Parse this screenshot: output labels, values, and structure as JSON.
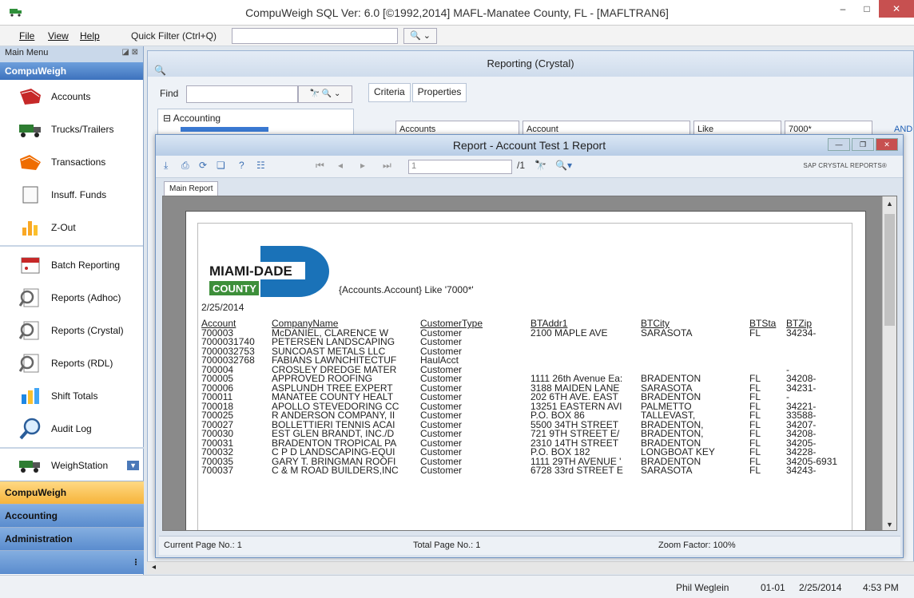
{
  "window": {
    "title": "CompuWeigh SQL Ver: 6.0 [©1992,2014]  MAFL-Manatee County, FL - [MAFLTRAN6]",
    "minimize": "–",
    "maximize": "□",
    "close": "✕"
  },
  "menubar": {
    "file": "File",
    "view": "View",
    "help": "Help",
    "quick_filter_label": "Quick Filter (Ctrl+Q)",
    "quick_filter_value": "",
    "quick_filter_btn": "🔍 ⌄"
  },
  "nav": {
    "header": "Main Menu",
    "group": "CompuWeigh",
    "items": [
      {
        "label": "Accounts"
      },
      {
        "label": "Trucks/Trailers"
      },
      {
        "label": "Transactions"
      },
      {
        "label": "Insuff. Funds",
        "icon_text": "IOU"
      },
      {
        "label": "Z-Out"
      }
    ],
    "items2": [
      {
        "label": "Batch Reporting"
      },
      {
        "label": "Reports (Adhoc)"
      },
      {
        "label": "Reports (Crystal)"
      },
      {
        "label": "Reports (RDL)"
      },
      {
        "label": "Shift Totals"
      },
      {
        "label": "Audit Log"
      }
    ],
    "weighstation": "WeighStation",
    "tabs": [
      "CompuWeigh",
      "Accounting",
      "Administration"
    ]
  },
  "reporting": {
    "title": "Reporting (Crystal)",
    "find_label": "Find",
    "find_buttons": "🔭 🔍 ⌄",
    "tree_root": "⊟ Accounting",
    "tabs": [
      "Criteria",
      "Properties"
    ],
    "criteria": [
      "Accounts",
      "Account",
      "Like",
      "7000*"
    ],
    "and_link": "AND"
  },
  "report": {
    "title": "Report - Account Test 1 Report",
    "page_box": "1",
    "page_of": "/1",
    "brand": "SAP CRYSTAL REPORTS®",
    "main_tab": "Main Report",
    "logo_top": "MIAMI-DADE",
    "logo_bottom": "COUNTY",
    "criteria_text": "{Accounts.Account} Like '7000*'",
    "date": "2/25/2014",
    "columns": [
      "Account",
      "CompanyName",
      "CustomerType",
      "BTAddr1",
      "BTCity",
      "BTSta",
      "BTZip"
    ],
    "rows": [
      [
        "700003",
        "McDANIEL, CLARENCE W",
        "Customer",
        "2100 MAPLE AVE",
        "SARASOTA",
        "FL",
        "34234-"
      ],
      [
        "7000031740",
        "PETERSEN LANDSCAPING",
        "Customer",
        "",
        "",
        "",
        ""
      ],
      [
        "7000032753",
        "SUNCOAST METALS LLC",
        "Customer",
        "",
        "",
        "",
        ""
      ],
      [
        "7000032768",
        "FABIANS LAWNCHITECTUF",
        "HaulAcct",
        "",
        "",
        "",
        ""
      ],
      [
        "700004",
        "CROSLEY DREDGE MATER",
        "Customer",
        "",
        "",
        "",
        "-"
      ],
      [
        "700005",
        "APPROVED ROOFING",
        "Customer",
        "1111 26th Avenue Ea:",
        "BRADENTON",
        "FL",
        "34208-"
      ],
      [
        "700006",
        "ASPLUNDH TREE EXPERT",
        "Customer",
        "3188 MAIDEN LANE",
        "SARASOTA",
        "FL",
        "34231-"
      ],
      [
        "700011",
        "MANATEE COUNTY HEALT",
        "Customer",
        "202 6TH AVE. EAST",
        "BRADENTON",
        "FL",
        "-"
      ],
      [
        "700018",
        "APOLLO STEVEDORING CC",
        "Customer",
        "13251 EASTERN AVI",
        "PALMETTO",
        "FL",
        "34221-"
      ],
      [
        "700025",
        "R ANDERSON COMPANY, II",
        "Customer",
        "P.O. BOX 86",
        "TALLEVAST,",
        "FL",
        "33588-"
      ],
      [
        "700027",
        "BOLLETTIERI TENNIS ACAI",
        "Customer",
        "5500 34TH STREET",
        "BRADENTON,",
        "FL",
        "34207-"
      ],
      [
        "700030",
        "EST GLEN BRANDT, INC./D",
        "Customer",
        "721 9TH STREET E/",
        "BRADENTON,",
        "FL",
        "34208-"
      ],
      [
        "700031",
        "BRADENTON TROPICAL PA",
        "Customer",
        "2310 14TH STREET",
        "BRADENTON",
        "FL",
        "34205-"
      ],
      [
        "700032",
        "C P D LANDSCAPING-EQUI",
        "Customer",
        "P.O. BOX 182",
        "LONGBOAT KEY",
        "FL",
        "34228-"
      ],
      [
        "700035",
        "GARY T. BRINGMAN ROOFI",
        "Customer",
        "1111 29TH AVENUE '",
        "BRADENTON",
        "FL",
        "34205-6931"
      ],
      [
        "700037",
        "C & M ROAD BUILDERS,INC",
        "Customer",
        "6728 33rd STREET E",
        "SARASOTA",
        "FL",
        "34243-"
      ]
    ],
    "status_current": "Current Page No.: 1",
    "status_total": "Total Page No.: 1",
    "status_zoom": "Zoom Factor: 100%"
  },
  "statusbar": {
    "user": "Phil Weglein",
    "code": "01-01",
    "date": "2/25/2014",
    "time": "4:53 PM"
  }
}
